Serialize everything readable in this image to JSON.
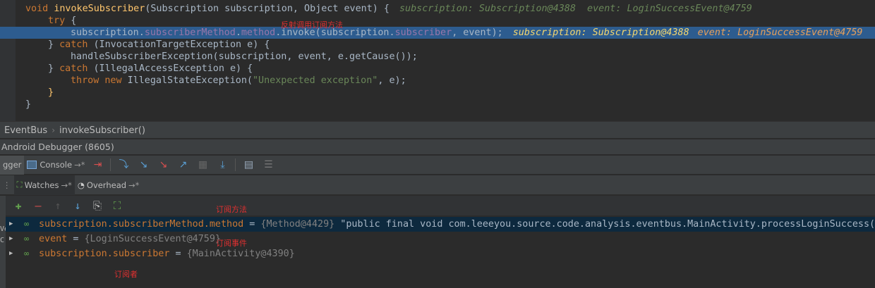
{
  "editor": {
    "lines": {
      "l0": {
        "a": "void ",
        "b": "invokeSubscriber",
        "c": "(Subscription subscription, Object event) {",
        "hint": "subscription: Subscription@4388  event: LoginSuccessEvent@4759"
      },
      "l1": {
        "a": "try",
        "b": " {"
      },
      "l2": {
        "a": "subscription.",
        "b": "subscriberMethod",
        "c": ".",
        "d": "method",
        "e": ".invoke(subscription.",
        "f": "subscriber",
        "g": ", event);",
        "hint1": "subscription: Subscription@4388",
        "hint2": "event: LoginSuccessEvent@4759"
      },
      "l3": {
        "a": "} ",
        "b": "catch",
        "c": " (InvocationTargetException e) {"
      },
      "l4": {
        "a": "handleSubscriberException(subscription, event, e.getCause());"
      },
      "l5": {
        "a": "} ",
        "b": "catch",
        "c": " (IllegalAccessException e) {"
      },
      "l6": {
        "a": "throw new",
        "b": " IllegalStateException(",
        "c": "\"Unexpected exception\"",
        "d": ", e);"
      },
      "l7": {
        "a": "}"
      },
      "l8": {
        "a": "}"
      }
    },
    "annotation": "反射调用订阅方法"
  },
  "breadcrumb": {
    "items": [
      "EventBus",
      "invokeSubscriber()"
    ]
  },
  "debugger": {
    "title": "Android Debugger (8605)",
    "tabs": {
      "debugger": "gger",
      "console": "Console"
    },
    "watch_tabs": {
      "watches": "Watches",
      "overhead": "Overhead"
    }
  },
  "watches": {
    "rows": [
      {
        "expr": "subscription.subscriberMethod.method",
        "eq": " = ",
        "type": "{Method@4429}",
        "value": " \"public final void com.leeeyou.source.code.analysis.eventbus.MainActivity.processLoginSuccess(c"
      },
      {
        "expr": "event",
        "eq": " = ",
        "type": "{LoginSuccessEvent@4759}",
        "value": ""
      },
      {
        "expr": "subscription.subscriber",
        "eq": " = ",
        "type": "{MainActivity@4390}",
        "value": ""
      }
    ],
    "annotations": [
      "订阅方法",
      "订阅事件",
      "订阅者"
    ]
  },
  "left_strip": {
    "v": "Ve",
    "c": "C"
  },
  "colors": {
    "accent": "#2d5c8f",
    "selection": "#0d293e",
    "annotation": "#e03030"
  }
}
